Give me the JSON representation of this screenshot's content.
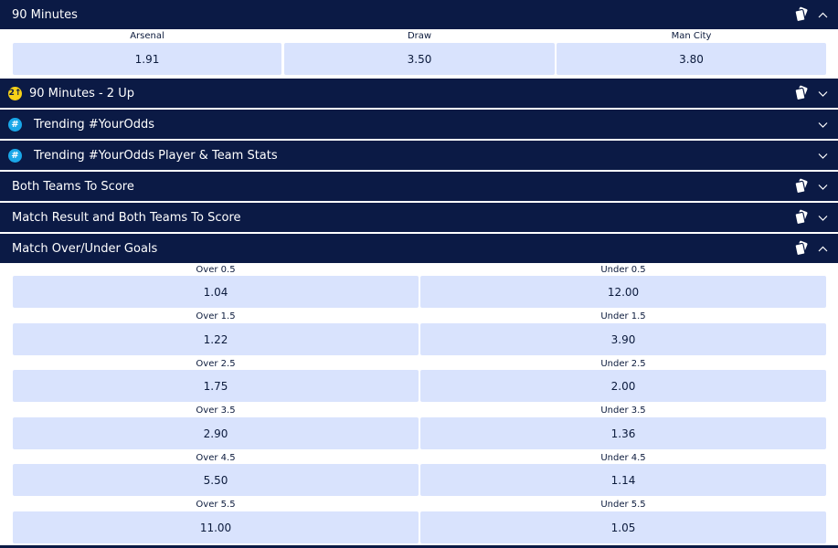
{
  "markets": {
    "ninety_minutes": {
      "title": "90 Minutes",
      "outcomes": [
        {
          "label": "Arsenal",
          "odds": "1.91"
        },
        {
          "label": "Draw",
          "odds": "3.50"
        },
        {
          "label": "Man City",
          "odds": "3.80"
        }
      ]
    },
    "two_up": {
      "badge": "2↑",
      "title": "90 Minutes - 2 Up"
    },
    "trending": {
      "badge": "#",
      "title": "Trending #YourOdds"
    },
    "trending_stats": {
      "badge": "#",
      "title": "Trending #YourOdds Player & Team Stats"
    },
    "btts": {
      "title": "Both Teams To Score"
    },
    "result_btts": {
      "title": "Match Result and Both Teams To Score"
    },
    "over_under": {
      "title": "Match Over/Under Goals",
      "rows": [
        {
          "over_label": "Over 0.5",
          "over_odds": "1.04",
          "under_label": "Under 0.5",
          "under_odds": "12.00"
        },
        {
          "over_label": "Over 1.5",
          "over_odds": "1.22",
          "under_label": "Under 1.5",
          "under_odds": "3.90"
        },
        {
          "over_label": "Over 2.5",
          "over_odds": "1.75",
          "under_label": "Under 2.5",
          "under_odds": "2.00"
        },
        {
          "over_label": "Over 3.5",
          "over_odds": "2.90",
          "under_label": "Under 3.5",
          "under_odds": "1.36"
        },
        {
          "over_label": "Over 4.5",
          "over_odds": "5.50",
          "under_label": "Under 4.5",
          "under_odds": "1.14"
        },
        {
          "over_label": "Over 5.5",
          "over_odds": "11.00",
          "under_label": "Under 5.5",
          "under_odds": "1.05"
        }
      ]
    }
  },
  "icons": {
    "bet_builder": "bet-builder-icon",
    "chevron_up": "chevron-up-icon",
    "chevron_down": "chevron-down-icon"
  },
  "colors": {
    "header_bg": "#0b1a45",
    "odds_bg": "#d9e3fd",
    "badge_2up": "#f7d117",
    "badge_hash": "#1aa7e8"
  }
}
